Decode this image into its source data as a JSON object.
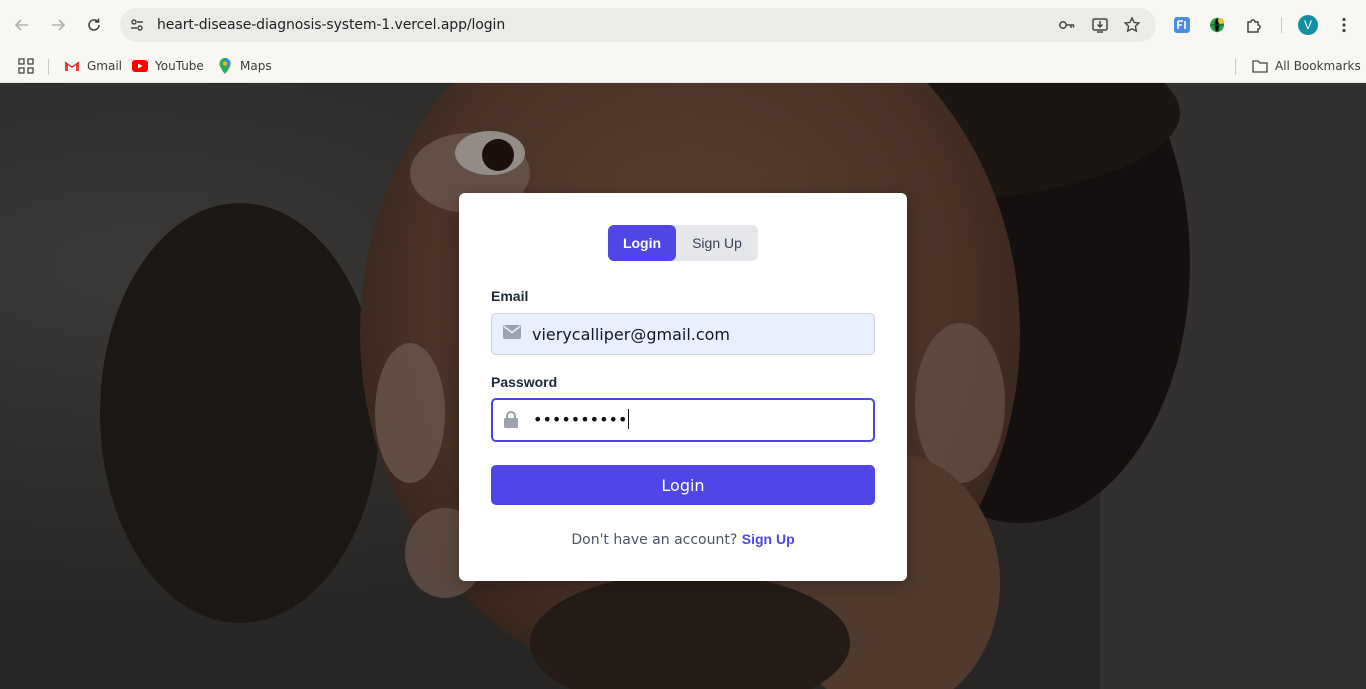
{
  "browser": {
    "url": "heart-disease-diagnosis-system-1.vercel.app/login",
    "profile_initial": "V",
    "icons": {
      "back": "arrow-left-icon",
      "forward": "arrow-right-icon",
      "reload": "reload-icon",
      "site_info": "tune-icon",
      "password": "key-icon",
      "install": "install-app-icon",
      "bookmark": "star-icon",
      "extensions": "puzzle-icon",
      "menu": "kebab-menu-icon"
    }
  },
  "bookmarks": {
    "items": [
      {
        "label": "Gmail",
        "icon": "gmail-icon"
      },
      {
        "label": "YouTube",
        "icon": "youtube-icon"
      },
      {
        "label": "Maps",
        "icon": "maps-icon"
      }
    ],
    "all_bookmarks": "All Bookmarks"
  },
  "login_card": {
    "tabs": {
      "login": "Login",
      "signup": "Sign Up"
    },
    "email": {
      "label": "Email",
      "value": "vierycalliper@gmail.com"
    },
    "password": {
      "label": "Password",
      "masked_value": "••••••••••"
    },
    "submit_label": "Login",
    "footer": {
      "prompt": "Don't have an account?",
      "link": "Sign Up"
    }
  },
  "colors": {
    "accent": "#4f46e5",
    "autofill_bg": "#e8f0fe",
    "tab_bg": "#e5e7eb"
  }
}
